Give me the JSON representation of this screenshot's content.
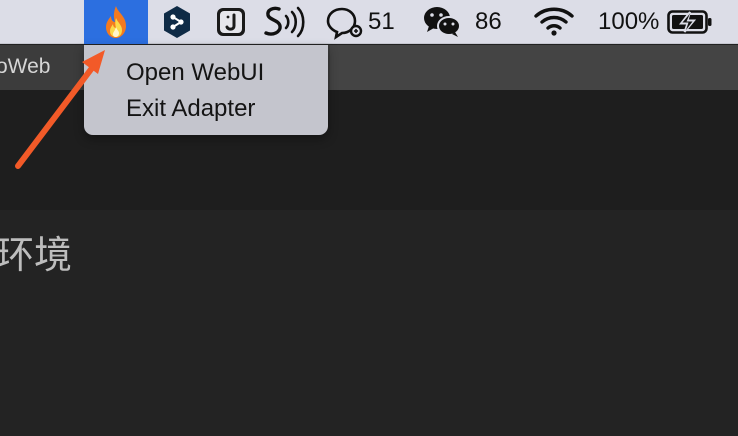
{
  "menubar": {
    "tray_app_icon": "flame-icon",
    "icons": [
      "deepl-icon",
      "jsonbox-icon",
      "speech-icon",
      "qq-icon",
      "wechat-icon",
      "wifi-icon",
      "battery-charging-icon"
    ],
    "qq_count": "51",
    "wechat_count": "86",
    "battery_percent": "100%",
    "highlight_color": "#2c6fe0"
  },
  "dropdown": {
    "items": [
      {
        "label": "Open WebUI"
      },
      {
        "label": "Exit Adapter"
      }
    ]
  },
  "window": {
    "title_fragment": "oWeb",
    "heading_fragment": "环境"
  },
  "annotation": {
    "arrow_color": "#f25a28"
  }
}
